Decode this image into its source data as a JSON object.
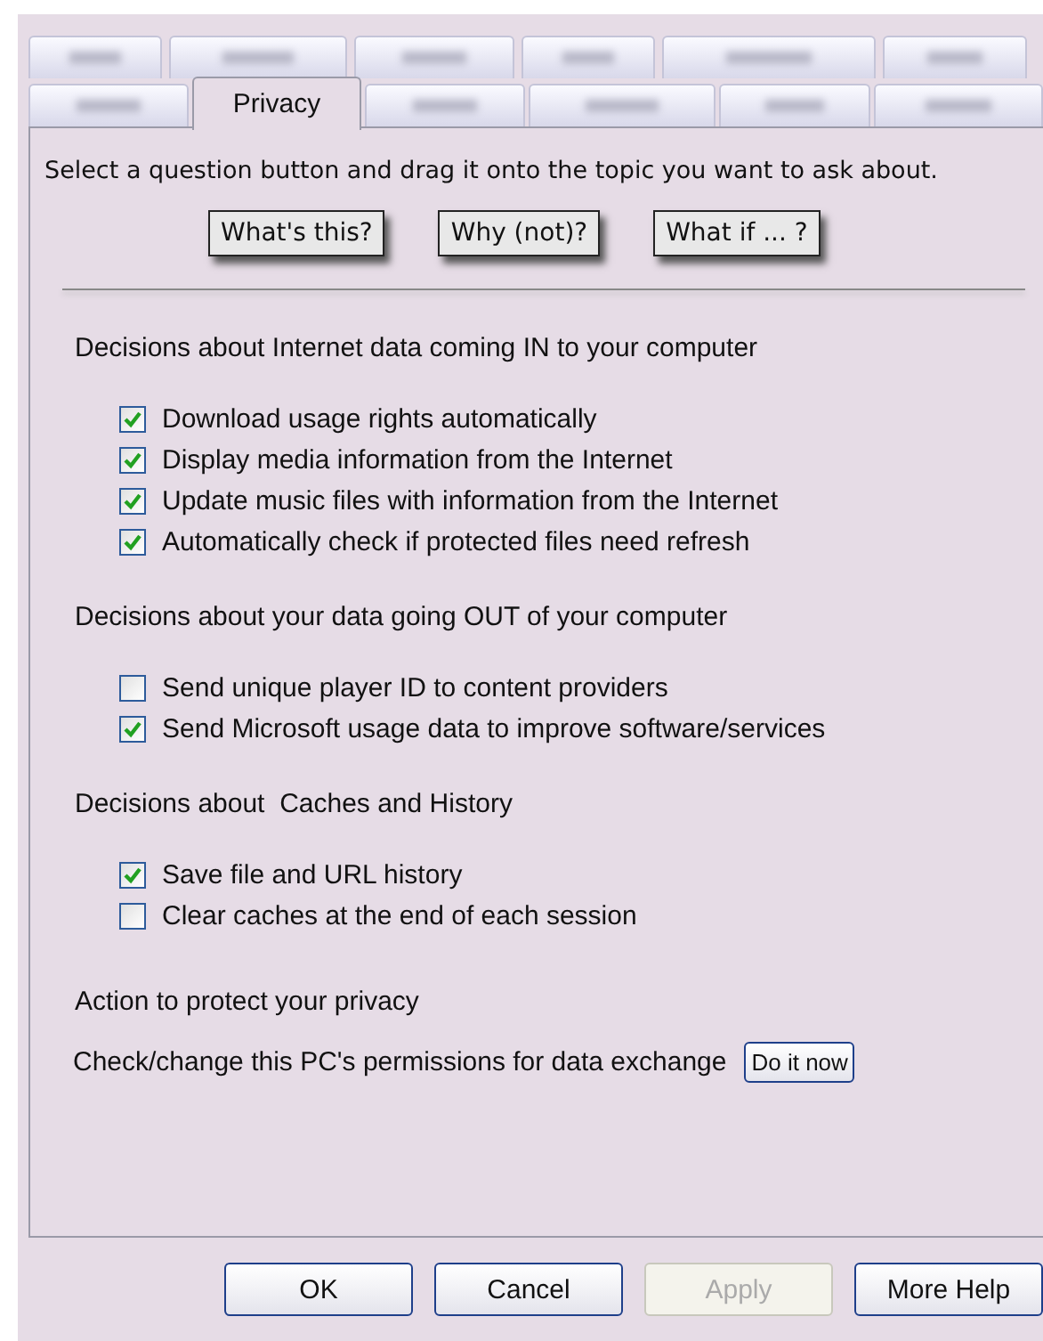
{
  "tabs": [
    [
      {
        "selected": false
      },
      {
        "selected": false
      },
      {
        "selected": false
      },
      {
        "selected": false
      },
      {
        "selected": false
      },
      {
        "selected": false
      }
    ],
    [
      {
        "selected": false
      },
      {
        "label": "Privacy",
        "selected": true
      },
      {
        "selected": false
      },
      {
        "selected": false
      },
      {
        "selected": false
      },
      {
        "selected": false
      }
    ]
  ],
  "intro": "Select a question button and drag it onto the topic you want to ask about.",
  "question_buttons": [
    "What's this?",
    "Why (not)?",
    "What if ... ?"
  ],
  "sections": [
    {
      "heading": "Decisions about Internet data coming IN to your computer",
      "options": [
        {
          "label": "Download usage rights automatically",
          "checked": true
        },
        {
          "label": "Display media information from the Internet",
          "checked": true
        },
        {
          "label": "Update music files with information from the Internet",
          "checked": true
        },
        {
          "label": "Automatically check if protected files need refresh",
          "checked": true
        }
      ]
    },
    {
      "heading": "Decisions about your data going OUT of your computer",
      "options": [
        {
          "label": "Send unique player ID to content providers",
          "checked": false
        },
        {
          "label": "Send Microsoft usage data to improve software/services",
          "checked": true
        }
      ]
    },
    {
      "heading": "Decisions about  Caches and History",
      "options": [
        {
          "label": "Save file and URL history",
          "checked": true
        },
        {
          "label": "Clear caches at the end of each session",
          "checked": false
        }
      ]
    }
  ],
  "action": {
    "heading": "Action to protect your privacy",
    "text": "Check/change this PC's permissions for data exchange",
    "button": "Do it now"
  },
  "buttons": [
    {
      "label": "OK",
      "disabled": false
    },
    {
      "label": "Cancel",
      "disabled": false
    },
    {
      "label": "Apply",
      "disabled": true
    },
    {
      "label": "More Help",
      "disabled": false
    }
  ]
}
